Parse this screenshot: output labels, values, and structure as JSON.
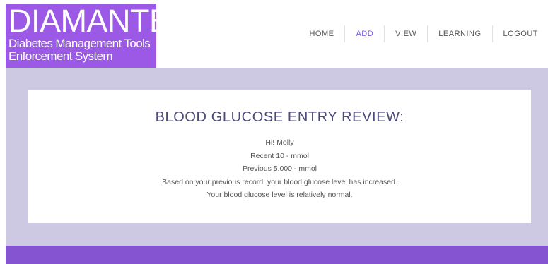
{
  "logo": {
    "title": "DIAMANTES",
    "subtitle_line1": "Diabetes Management Tools",
    "subtitle_line2": "Enforcement System"
  },
  "nav": {
    "items": [
      {
        "label": "HOME"
      },
      {
        "label": "ADD"
      },
      {
        "label": "VIEW"
      },
      {
        "label": "LEARNING"
      },
      {
        "label": "LOGOUT"
      }
    ],
    "active": "ADD"
  },
  "review": {
    "title": "BLOOD GLUCOSE ENTRY REVIEW:",
    "greeting": "Hi! Molly",
    "recent": "Recent 10 - mmol",
    "previous": "Previous 5.000 - mmol",
    "trend_message": "Based on your previous record, your blood glucose level has increased.",
    "status_message": "Your blood glucose level is relatively normal."
  },
  "colors": {
    "brand_purple": "#9b59e6",
    "band_lavender": "#cdc9e3",
    "footer_purple": "#8454d1",
    "title_color": "#4b4a7b",
    "active_nav": "#7b5bd6"
  }
}
